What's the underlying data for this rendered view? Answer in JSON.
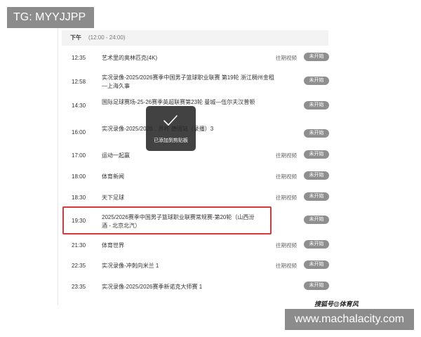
{
  "tg_badge": "TG: MYYJJPP",
  "section": {
    "period": "下午",
    "range": "(12:00 - 24:00)"
  },
  "rows": [
    {
      "time": "12:35",
      "title": "艺术里的奥林匹克(4K)",
      "replay": "往期视频",
      "status": "未开始"
    },
    {
      "time": "12:58",
      "title": "实况录像-2025/2026赛季中国男子篮球职业联赛 第19轮 浙江稠州金租—上海久事",
      "replay": "",
      "status": "未开始"
    },
    {
      "time": "14:30",
      "title": "国际足球赛场-25-26赛季英超联赛第23轮 曼城—伍尔夫汉普顿",
      "replay": "",
      "status": "未开始"
    },
    {
      "time": "16:00",
      "title": "实况录像-2025/2026…界杯 德国站（录播）3",
      "replay": "",
      "status": "未开始"
    },
    {
      "time": "17:00",
      "title": "运动一起赢",
      "replay": "往期视频",
      "status": "未开始"
    },
    {
      "time": "18:00",
      "title": "体育新闻",
      "replay": "往期视频",
      "status": "未开始"
    },
    {
      "time": "18:30",
      "title": "天下足球",
      "replay": "往期视频",
      "status": "未开始"
    },
    {
      "time": "19:30",
      "title": "2025/2026赛季中国男子篮球职业联赛常规赛-第20轮（山西汾酒 - 北京北汽）",
      "replay": "",
      "status": "未开始"
    },
    {
      "time": "21:30",
      "title": "体育世界",
      "replay": "往期视频",
      "status": "未开始"
    },
    {
      "time": "22:35",
      "title": "实况录像-冲刺向米兰 1",
      "replay": "往期视频",
      "status": "未开始"
    },
    {
      "time": "23:35",
      "title": "实况录像-2025/2026赛季新诺克大师赛 1",
      "replay": "",
      "status": "未开始"
    }
  ],
  "toast": {
    "text": "已添加到剪贴板",
    "icon": "check-icon"
  },
  "watermark": "搜狐号@体育风",
  "url_badge": "www.machalacity.com"
}
